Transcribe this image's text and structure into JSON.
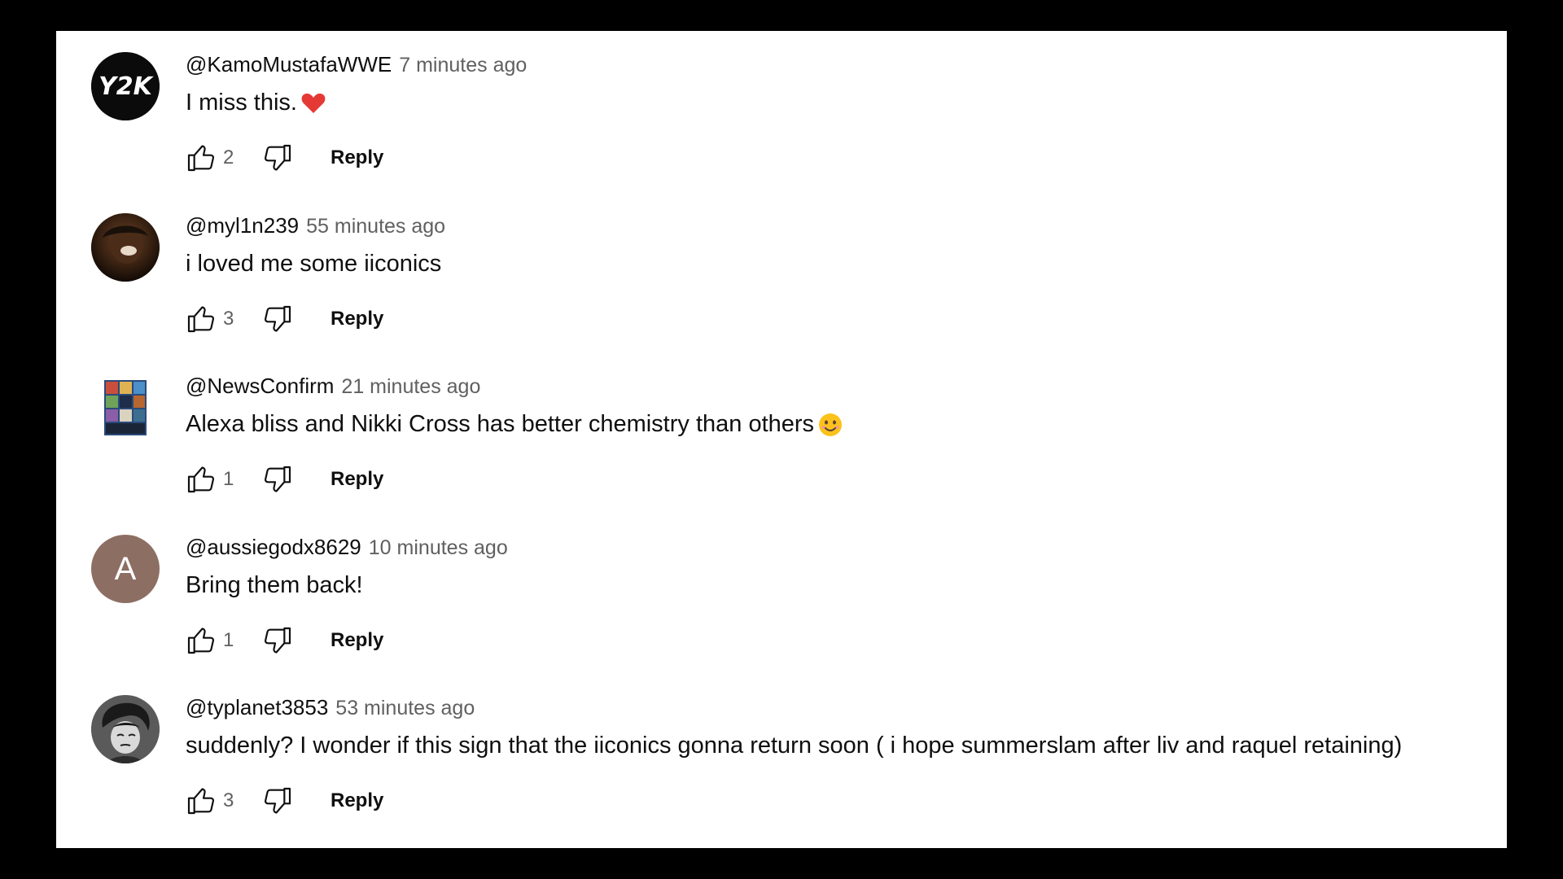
{
  "comments": [
    {
      "author": "@KamoMustafaWWE",
      "time": "7 minutes ago",
      "text": "I miss this.",
      "emoji": "heart-emoji",
      "likes": "2",
      "reply_label": "Reply",
      "avatar": {
        "type": "logo",
        "logo_text": "Y2K",
        "bg": "#0b0b0b"
      }
    },
    {
      "author": "@myl1n239",
      "time": "55 minutes ago",
      "text": "i loved me some iiconics",
      "emoji": null,
      "likes": "3",
      "reply_label": "Reply",
      "avatar": {
        "type": "photo",
        "bg": "#2a1a10"
      }
    },
    {
      "author": "@NewsConfirm",
      "time": "21 minutes ago",
      "text": "Alexa bliss and Nikki Cross has better chemistry than others",
      "emoji": "smile-emoji",
      "likes": "1",
      "reply_label": "Reply",
      "avatar": {
        "type": "collage",
        "bg": "#ffffff"
      }
    },
    {
      "author": "@aussiegodx8629",
      "time": "10 minutes ago",
      "text": "Bring them back!",
      "emoji": null,
      "likes": "1",
      "reply_label": "Reply",
      "avatar": {
        "type": "letter",
        "letter": "A",
        "bg": "#8d6e63"
      }
    },
    {
      "author": "@typlanet3853",
      "time": "53 minutes ago",
      "text": "suddenly? I wonder if this sign that the iiconics gonna return soon ( i hope summerslam after liv and raquel retaining)",
      "emoji": null,
      "likes": "3",
      "reply_label": "Reply",
      "avatar": {
        "type": "cartoon",
        "bg": "#5a5a5a"
      }
    }
  ],
  "colors": {
    "background": "#000000",
    "panel": "#ffffff",
    "author": "#0f0f0f",
    "meta": "#606060"
  },
  "icons": {
    "like": "thumbs-up-icon",
    "dislike": "thumbs-down-icon"
  }
}
